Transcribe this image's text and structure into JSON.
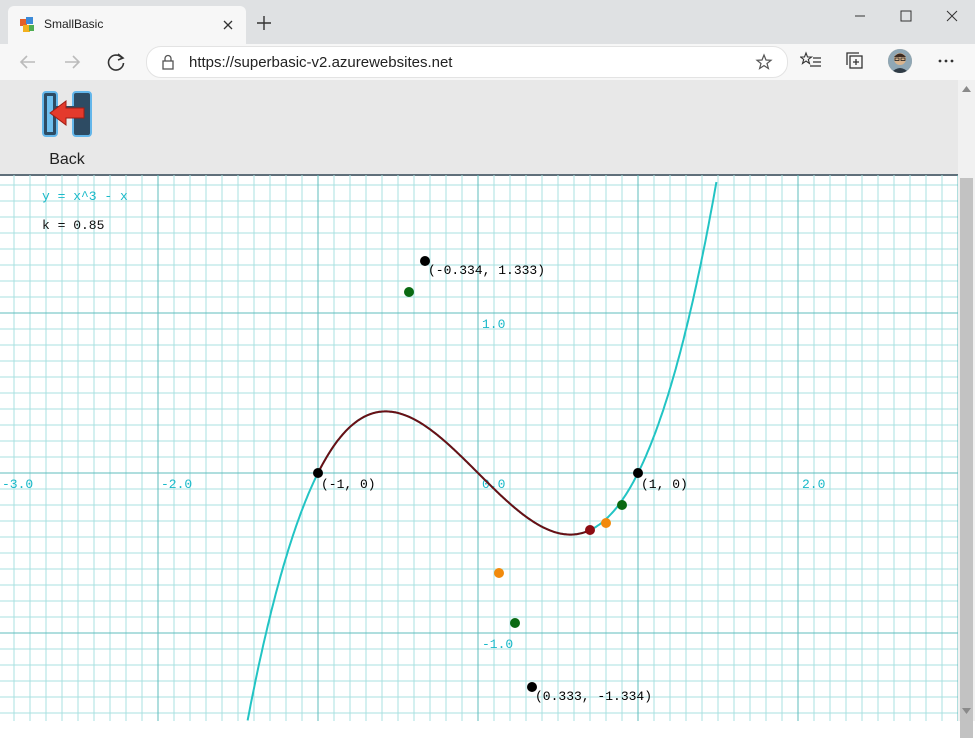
{
  "browser": {
    "tab_title": "SmallBasic",
    "url": "https://superbasic-v2.azurewebsites.net"
  },
  "app": {
    "back_label": "Back"
  },
  "graph": {
    "equation": "y = x^3 - x",
    "k_label": "k = 0.85",
    "axis_labels": {
      "x": [
        "-3.0",
        "-2.0",
        "0.0",
        "2.0"
      ],
      "y": [
        "1.0",
        "-1.0"
      ]
    },
    "point_labels": {
      "root_left": "(-1, 0)",
      "root_right": "(1, 0)",
      "local_max": "(-0.334, 1.333)",
      "local_min": "(0.333, -1.334)"
    },
    "colors": {
      "grid_minor": "#a8e0e0",
      "grid_major": "#5fbcbc",
      "curve": "#22c4c4",
      "highlight": "#6b0f14",
      "label": "#19b9c9"
    }
  }
}
